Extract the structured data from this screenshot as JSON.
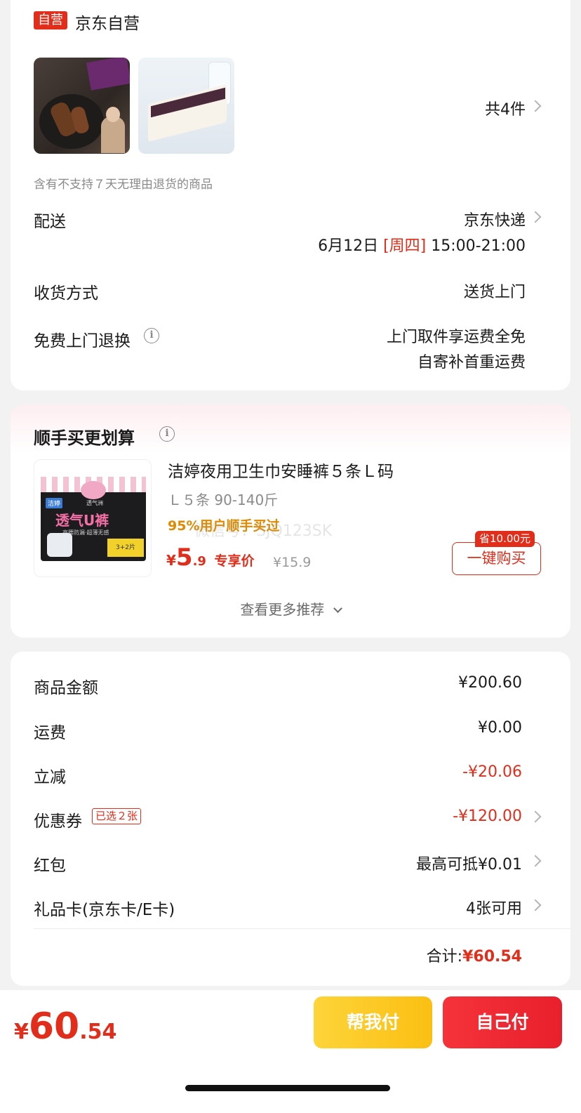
{
  "shop": {
    "badge": "自营",
    "name": "京东自营"
  },
  "items": {
    "count_label": "共4件"
  },
  "notice": "含有不支持７天无理由退货的商品",
  "delivery": {
    "label": "配送",
    "carrier": "京东快递",
    "date": "6月12日",
    "weekday": "[周四]",
    "time": "15:00-21:00"
  },
  "receive": {
    "label": "收货方式",
    "value": "送货上门"
  },
  "return_exchange": {
    "label": "免费上门退换",
    "line1": "上门取件享运费全免",
    "line2": "自寄补首重运费"
  },
  "recommend": {
    "title": "顺手买更划算",
    "product_name": "洁婷夜用卫生巾安睡裤５条Ｌ码",
    "spec": "Ｌ５条 90-140斤",
    "promo": "95%用户顺手买过",
    "price_symbol": "¥",
    "price_int": "5",
    "price_dec": ".9",
    "price_tag": "专享价",
    "orig_price": "¥15.9",
    "save_badge": "省10.00元",
    "buy_button": "一键购买",
    "more": "查看更多推荐",
    "package": {
      "brand": "洁婷",
      "sub_brand": "透气洲",
      "main": "透气U裤",
      "tagline": "高腰防漏·超薄无感",
      "count": "3+2片"
    }
  },
  "summary": {
    "goods_label": "商品金额",
    "goods_value": "¥200.60",
    "shipping_label": "运费",
    "shipping_value": "¥0.00",
    "discount_label": "立减",
    "discount_value": "-¥20.06",
    "coupon_label": "优惠券",
    "coupon_badge": "已选２张",
    "coupon_value": "-¥120.00",
    "redpacket_label": "红包",
    "redpacket_value": "最高可抵¥0.01",
    "giftcard_label": "礼品卡(京东卡/E卡)",
    "giftcard_value": "4张可用",
    "total_label": "合计:",
    "total_value": "¥60.54"
  },
  "bottom": {
    "price_symbol": "¥",
    "price_int": "60",
    "price_dec": ".54",
    "help_pay": "帮我付",
    "self_pay": "自己付"
  },
  "watermark": "微信号：SJQ123SK",
  "colors": {
    "accent_red": "#e22d1b",
    "promo_orange": "#e08a00",
    "yellow_btn": "#fcc520"
  }
}
